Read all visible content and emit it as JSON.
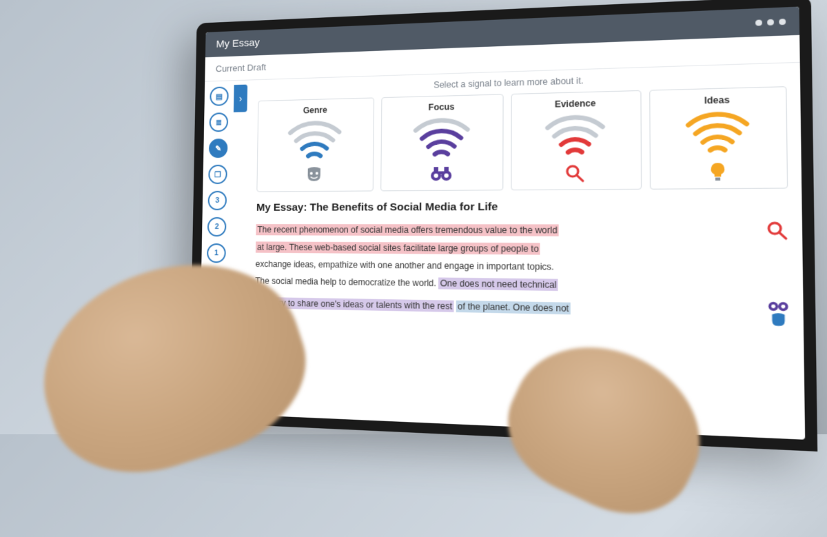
{
  "window": {
    "title": "My Essay"
  },
  "draft": {
    "label": "Current Draft"
  },
  "sidebar": {
    "expand_glyph": "›",
    "items": [
      {
        "icon": "document-icon",
        "glyph": "▤"
      },
      {
        "icon": "list-icon",
        "glyph": "≣"
      },
      {
        "icon": "pencil-icon",
        "glyph": "✎",
        "active": true
      },
      {
        "icon": "copy-icon",
        "glyph": "❐"
      },
      {
        "icon": "step-3",
        "glyph": "3"
      },
      {
        "icon": "step-2",
        "glyph": "2"
      },
      {
        "icon": "step-1",
        "glyph": "1"
      }
    ]
  },
  "signals": {
    "prompt": "Select a signal to learn more about it.",
    "cards": [
      {
        "label": "Genre",
        "color": "#2f7bbf",
        "bars": 2,
        "icon": "mask-icon"
      },
      {
        "label": "Focus",
        "color": "#5a3f9e",
        "bars": 3,
        "icon": "binoculars-icon"
      },
      {
        "label": "Evidence",
        "color": "#e23a3a",
        "bars": 2,
        "icon": "magnifier-icon"
      },
      {
        "label": "Ideas",
        "color": "#f5a623",
        "bars": 4,
        "icon": "lightbulb-icon"
      }
    ]
  },
  "essay": {
    "title": "My Essay: The Benefits of Social Media for Life",
    "lines": [
      {
        "text": "The recent phenomenon of social media offers tremendous value to the world",
        "hl": "pink",
        "side": "magnifier-icon"
      },
      {
        "text": "at large. These web-based social sites facilitate large groups of people to",
        "hl": "pink"
      },
      {
        "text": "exchange ideas, empathize with one another and engage in important topics.",
        "hl": "none"
      },
      {
        "text": "The social media help to democratize the world. One does not need technical",
        "hl": "purple-partial"
      },
      {
        "text": "mastery to share one's ideas or talents with the rest of the planet. One does not",
        "hl": "purple-blue",
        "side": "binoculars-icon",
        "side2": "shield-icon"
      }
    ]
  }
}
